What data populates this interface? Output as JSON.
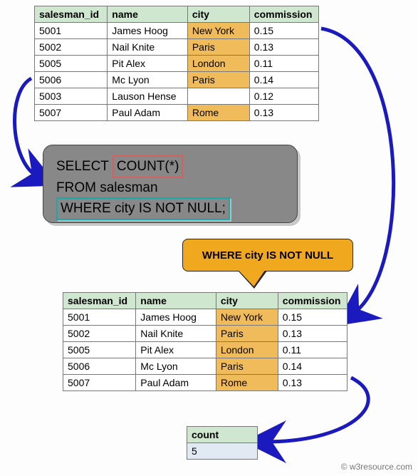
{
  "source_table": {
    "headers": [
      "salesman_id",
      "name",
      "city",
      "commission"
    ],
    "rows": [
      {
        "salesman_id": "5001",
        "name": "James Hoog",
        "city": "New York",
        "commission": "0.15"
      },
      {
        "salesman_id": "5002",
        "name": "Nail Knite",
        "city": "Paris",
        "commission": "0.13"
      },
      {
        "salesman_id": "5005",
        "name": "Pit Alex",
        "city": "London",
        "commission": "0.11"
      },
      {
        "salesman_id": "5006",
        "name": "Mc Lyon",
        "city": "Paris",
        "commission": "0.14"
      },
      {
        "salesman_id": "5003",
        "name": "Lauson Hense",
        "city": "",
        "commission": "0.12"
      },
      {
        "salesman_id": "5007",
        "name": "Paul Adam",
        "city": "Rome",
        "commission": "0.13"
      }
    ]
  },
  "sql": {
    "line1_pre": "SELECT ",
    "line1_count": "COUNT(*)",
    "line2": "FROM salesman",
    "line3": "WHERE city IS NOT NULL;"
  },
  "callout_text": "WHERE city IS NOT NULL",
  "filtered_table": {
    "headers": [
      "salesman_id",
      "name",
      "city",
      "commission"
    ],
    "rows": [
      {
        "salesman_id": "5001",
        "name": "James Hoog",
        "city": "New York",
        "commission": "0.15"
      },
      {
        "salesman_id": "5002",
        "name": "Nail Knite",
        "city": "Paris",
        "commission": "0.13"
      },
      {
        "salesman_id": "5005",
        "name": "Pit Alex",
        "city": "London",
        "commission": "0.11"
      },
      {
        "salesman_id": "5006",
        "name": "Mc Lyon",
        "city": "Paris",
        "commission": "0.14"
      },
      {
        "salesman_id": "5007",
        "name": "Paul Adam",
        "city": "Rome",
        "commission": "0.13"
      }
    ]
  },
  "result": {
    "header": "count",
    "value": "5"
  },
  "watermark": "© w3resource.com"
}
